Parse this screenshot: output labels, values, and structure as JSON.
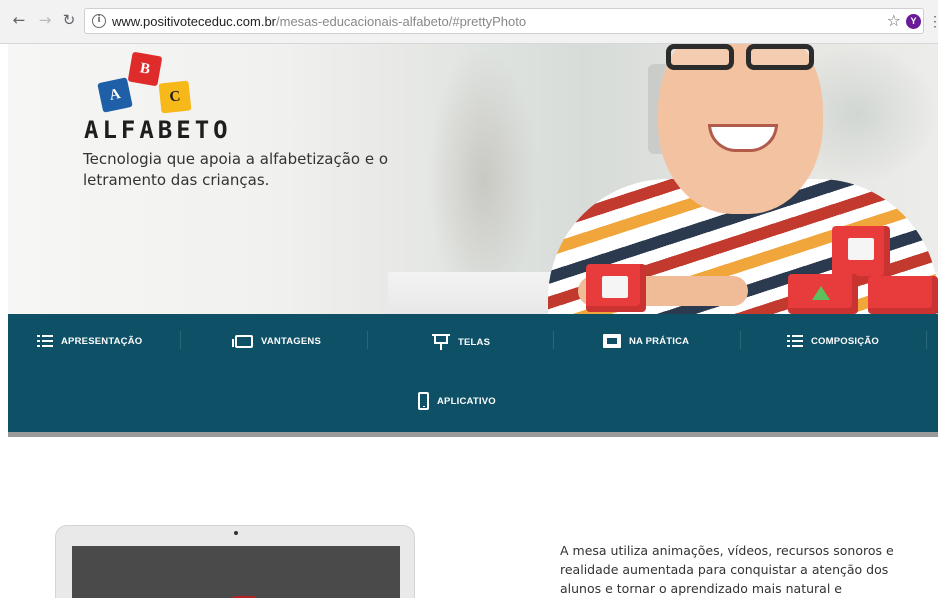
{
  "browser": {
    "url_host": "www.positivoteceduc.com.br",
    "url_path": "/mesas-educacionais-alfabeto/#prettyPhoto",
    "icons": [
      "back-icon",
      "forward-icon",
      "reload-icon",
      "info-icon",
      "star-icon",
      "extension-icon",
      "menu-icon"
    ],
    "extension_letter": "Y"
  },
  "hero": {
    "logo_letters": [
      "A",
      "B",
      "C"
    ],
    "brand": "ALFABETO",
    "tagline": "Tecnologia que apoia a alfabetização e o letramento das crianças."
  },
  "nav": {
    "items": [
      {
        "label": "APRESENTAÇÃO",
        "icon": "list-icon"
      },
      {
        "label": "VANTAGENS",
        "icon": "window-icon"
      },
      {
        "label": "TELAS",
        "icon": "easel-icon"
      },
      {
        "label": "NA PRÁTICA",
        "icon": "photo-icon"
      },
      {
        "label": "COMPOSIÇÃO",
        "icon": "list-icon"
      },
      {
        "label": "APLICATIVO",
        "icon": "phone-icon"
      }
    ],
    "colors": {
      "band": "#0e5066",
      "text": "#ffffff"
    }
  },
  "content": {
    "description": "A mesa utiliza animações, vídeos, recursos sonoros e realidade aumentada para conquistar a atenção dos alunos e tornar o aprendizado mais natural e"
  }
}
